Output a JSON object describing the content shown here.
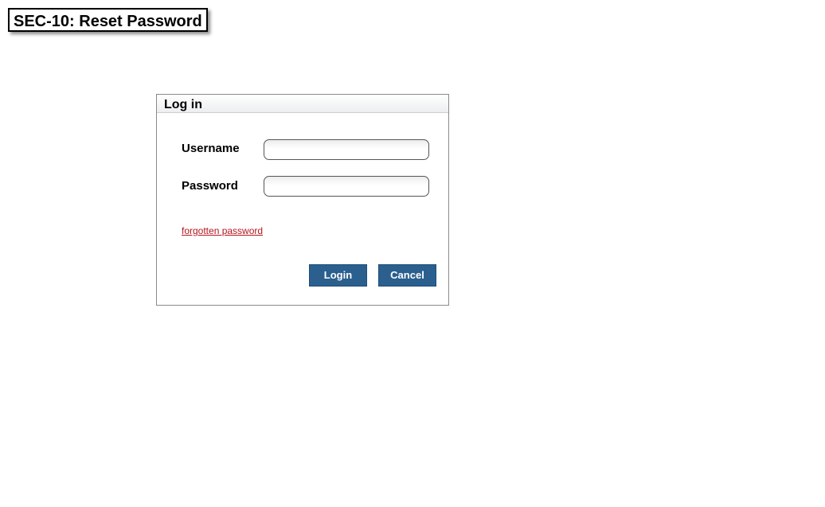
{
  "page": {
    "title": "SEC-10: Reset Password"
  },
  "login_panel": {
    "title": "Log in",
    "username_label": "Username",
    "username_value": "",
    "password_label": "Password",
    "password_value": "",
    "forgot_link": "forgotten password",
    "login_button": "Login",
    "cancel_button": "Cancel"
  },
  "colors": {
    "button_background": "#2b5f8e",
    "link": "#b3161d",
    "panel_border": "#8a8a8a"
  }
}
